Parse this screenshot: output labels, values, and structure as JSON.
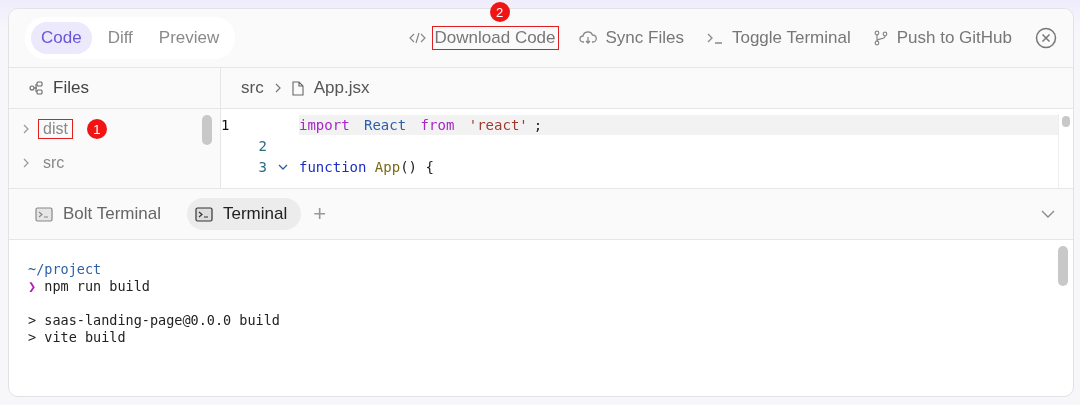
{
  "header": {
    "view_tabs": [
      {
        "label": "Code",
        "selected": true
      },
      {
        "label": "Diff",
        "selected": false
      },
      {
        "label": "Preview",
        "selected": false
      }
    ],
    "actions": [
      {
        "label": "Download Code",
        "highlighted": true,
        "marker": "2"
      },
      {
        "label": "Sync Files",
        "highlighted": false
      },
      {
        "label": "Toggle Terminal",
        "highlighted": false
      },
      {
        "label": "Push to GitHub",
        "highlighted": false
      }
    ]
  },
  "files": {
    "title": "Files",
    "items": [
      {
        "name": "dist",
        "expanded": false,
        "highlighted": true,
        "marker": "1"
      },
      {
        "name": "src",
        "expanded": false,
        "highlighted": false
      }
    ]
  },
  "editor": {
    "breadcrumb": [
      "src",
      "App.jsx"
    ],
    "lines": [
      {
        "number": "1",
        "active": true,
        "foldable": false,
        "tokens": [
          {
            "kind": "keyword",
            "text": "import"
          },
          {
            "kind": "ident",
            "text": " React "
          },
          {
            "kind": "keyword",
            "text": "from"
          },
          {
            "kind": "string",
            "text": " 'react'"
          },
          {
            "kind": "punct",
            "text": ";"
          }
        ]
      },
      {
        "number": "2",
        "active": false,
        "foldable": false
      },
      {
        "number": "3",
        "active": false,
        "foldable": true,
        "tokens": [
          {
            "kind": "decl",
            "text": "function"
          },
          {
            "kind": "func",
            "text": " App"
          },
          {
            "kind": "punct",
            "text": "() {"
          }
        ]
      }
    ]
  },
  "terminal": {
    "tabs": [
      {
        "label": "Bolt Terminal",
        "selected": false
      },
      {
        "label": "Terminal",
        "selected": true
      }
    ],
    "add": "+",
    "lines": [
      {
        "kind": "path",
        "text": "~/project"
      },
      {
        "kind": "prompt",
        "prompt": "❯",
        "text": "npm run build"
      },
      {
        "kind": "blank"
      },
      {
        "kind": "output",
        "text": "> saas-landing-page@0.0.0 build"
      },
      {
        "kind": "output",
        "text": "> vite build"
      }
    ]
  }
}
